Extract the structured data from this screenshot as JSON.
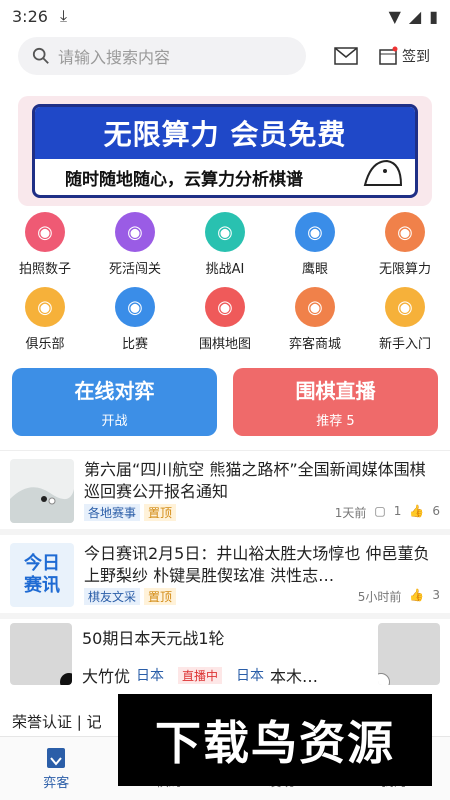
{
  "status": {
    "time": "3:26"
  },
  "search": {
    "placeholder": "请输入搜索内容"
  },
  "header": {
    "sign_label": "签到"
  },
  "banner": {
    "headline": "无限算力 会员免费",
    "sub": "随时随地随心，云算力分析棋谱"
  },
  "shortcuts": [
    {
      "label": "拍照数子",
      "color": "#ef5a74",
      "icon": "camera-icon"
    },
    {
      "label": "死活闯关",
      "color": "#9a5ce5",
      "icon": "ghost-icon"
    },
    {
      "label": "挑战AI",
      "color": "#29c1b0",
      "icon": "robot-icon"
    },
    {
      "label": "鹰眼",
      "color": "#3a8de8",
      "icon": "eagle-icon"
    },
    {
      "label": "无限算力",
      "color": "#f0814a",
      "icon": "power-icon"
    },
    {
      "label": "俱乐部",
      "color": "#f6b13a",
      "icon": "club-icon"
    },
    {
      "label": "比赛",
      "color": "#3a8de8",
      "icon": "trophy-icon"
    },
    {
      "label": "围棋地图",
      "color": "#ef5a5a",
      "icon": "map-pin-icon"
    },
    {
      "label": "弈客商城",
      "color": "#f0814a",
      "icon": "shop-icon"
    },
    {
      "label": "新手入门",
      "color": "#f6b13a",
      "icon": "beginner-icon"
    }
  ],
  "actions": {
    "play": {
      "title": "在线对弈",
      "sub": "开战",
      "color": "#3d8fe6"
    },
    "live": {
      "title": "围棋直播",
      "sub": "推荐 5",
      "color": "#ef6a6a"
    }
  },
  "news": [
    {
      "title": "第六届“四川航空 熊猫之路杯”全国新闻媒体围棋巡回赛公开报名通知",
      "tag": "各地赛事",
      "pin": "置顶",
      "time": "1天前",
      "comments": "1",
      "likes": "6"
    },
    {
      "title": "今日赛讯2月5日：井山裕太胜大场惇也 仲邑菫负上野梨纱 朴键昊胜偰玹准 洪性志…",
      "tag": "棋友文采",
      "pin": "置顶",
      "time": "5小时前",
      "likes": "3",
      "thumb_text": "今日赛讯"
    }
  ],
  "live_game": {
    "title": "50期日本天元战1轮",
    "player1": "大竹优",
    "country1": "日本",
    "status": "直播中",
    "country2": "日本",
    "player2": "本木…"
  },
  "cert_text": "荣誉认证 | 记",
  "tabs": [
    {
      "label": "弈客"
    },
    {
      "label": "棋局"
    },
    {
      "label": "发现"
    },
    {
      "label": "我的"
    }
  ],
  "watermark": "下载鸟资源"
}
